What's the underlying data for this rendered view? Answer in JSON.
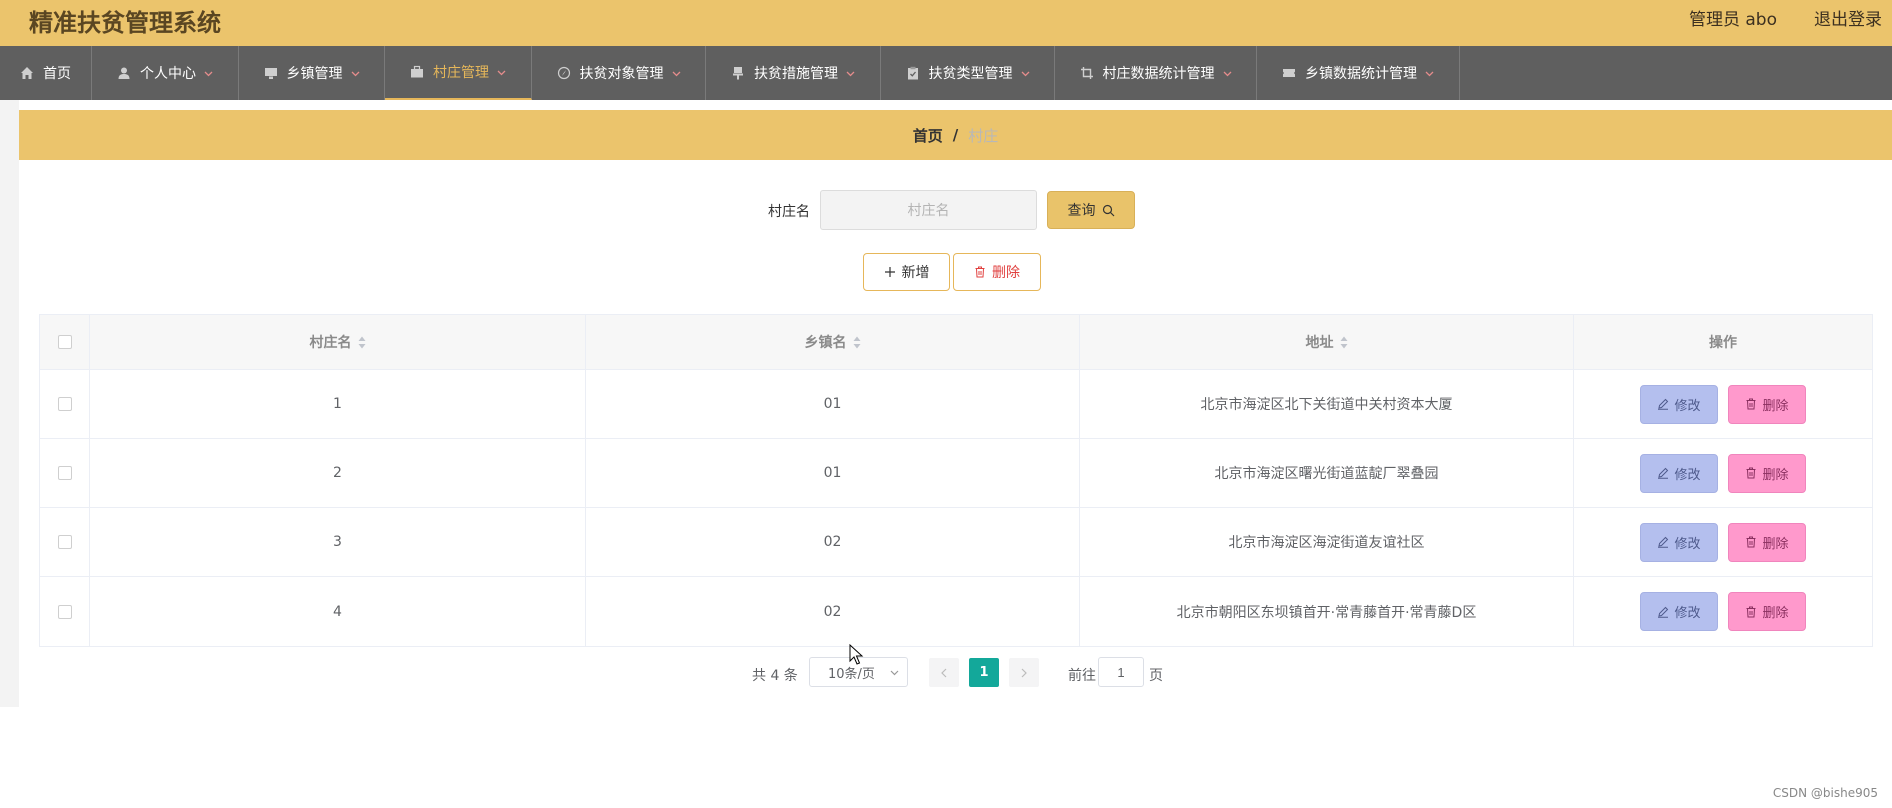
{
  "header": {
    "title": "精准扶贫管理系统",
    "admin_label": "管理员 abo",
    "logout_label": "退出登录"
  },
  "nav": {
    "items": [
      {
        "label": "首页",
        "icon": "home-icon"
      },
      {
        "label": "个人中心",
        "icon": "user-icon"
      },
      {
        "label": "乡镇管理",
        "icon": "monitor-icon"
      },
      {
        "label": "村庄管理",
        "icon": "briefcase-icon",
        "active": true
      },
      {
        "label": "扶贫对象管理",
        "icon": "compass-icon"
      },
      {
        "label": "扶贫措施管理",
        "icon": "stamp-icon"
      },
      {
        "label": "扶贫类型管理",
        "icon": "clipboard-icon"
      },
      {
        "label": "村庄数据统计管理",
        "icon": "crop-icon"
      },
      {
        "label": "乡镇数据统计管理",
        "icon": "ticket-icon"
      }
    ]
  },
  "breadcrumb": {
    "home": "首页",
    "separator": "/",
    "current": "村庄"
  },
  "search": {
    "label": "村庄名",
    "placeholder": "村庄名",
    "query_label": "查询"
  },
  "actions": {
    "add_label": "新增",
    "delete_label": "删除"
  },
  "table": {
    "columns": [
      "村庄名",
      "乡镇名",
      "地址",
      "操作"
    ],
    "rows": [
      {
        "village": "1",
        "town": "01",
        "address": "北京市海淀区北下关街道中关村资本大厦"
      },
      {
        "village": "2",
        "town": "01",
        "address": "北京市海淀区曙光街道蓝靛厂翠叠园"
      },
      {
        "village": "3",
        "town": "02",
        "address": "北京市海淀区海淀街道友谊社区"
      },
      {
        "village": "4",
        "town": "02",
        "address": "北京市朝阳区东坝镇首开·常青藤首开·常青藤D区"
      }
    ],
    "edit_label": "修改",
    "delete_label": "删除"
  },
  "pagination": {
    "total_label": "共 4 条",
    "page_size": "10条/页",
    "current_page": "1",
    "goto_label": "前往",
    "goto_value": "1",
    "goto_suffix": "页"
  },
  "watermark": "CSDN @bishe905",
  "colors": {
    "header": "#ebc46c",
    "nav": "#5f5f5f",
    "active": "#e6b75a",
    "page_active": "#13a89a",
    "edit": "#b4bfee",
    "delete": "#ff99cc"
  }
}
